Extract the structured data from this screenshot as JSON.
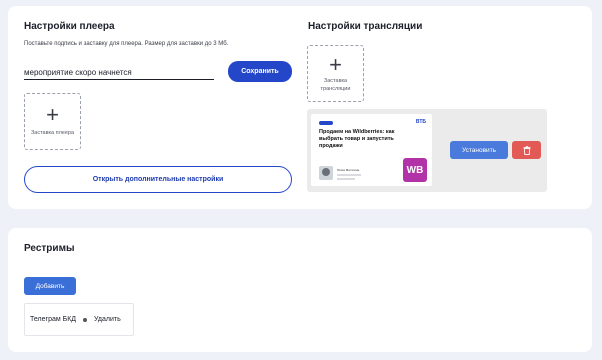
{
  "player": {
    "title": "Настройки плеера",
    "subtitle": "Поставьте подпись и заставку для плеера. Размер для заставки до 3 Мб.",
    "caption_value": "мероприятие скоро начнется",
    "save_label": "Сохранить",
    "splash_label": "Заставка плеера",
    "more_settings_label": "Открыть дополнительные настройки"
  },
  "broadcast": {
    "title": "Настройки трансляции",
    "splash_label": "Заставка трансляции",
    "preview": {
      "logo": "ВТБ",
      "headline": "Продаем на Wildberries: как выбрать товар и запустить продажи",
      "speaker_name": "Юлия Митягина",
      "brand_badge": "WB"
    },
    "install_label": "Установить",
    "delete_icon": "trash-icon",
    "delete_color": "#e25a56"
  },
  "restreams": {
    "title": "Рестримы",
    "add_label": "Добавить",
    "items": [
      {
        "name": "Телеграм БКД",
        "delete_label": "Удалить"
      }
    ]
  },
  "colors": {
    "accent": "#2446c9",
    "button_blue": "#4a7bdc",
    "wb_purple": "#b233a8",
    "background": "#eef1f8"
  }
}
